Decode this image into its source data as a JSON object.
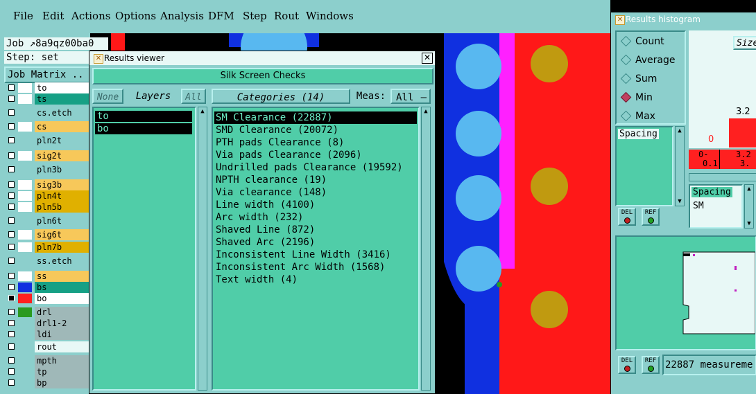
{
  "menu": [
    "File",
    "Edit",
    "Actions",
    "Options",
    "Analysis",
    "DFM",
    "Step",
    "Rout",
    "Windows"
  ],
  "job": {
    "label": "Job",
    "name": "8a9qz00ba0",
    "step_label": "Step: set",
    "matrix_label": "Job Matrix .."
  },
  "layers": [
    {
      "name": "to",
      "color": "#ffffff",
      "bg": "#ffffff"
    },
    {
      "name": "ts",
      "color": "#ffffff",
      "bg": "#16a085"
    },
    {
      "name": "cs.etch",
      "color": "#8ccfcc",
      "bg": "#8ccfcc"
    },
    {
      "name": "cs",
      "color": "#ffffff",
      "bg": "#f7c85a"
    },
    {
      "name": "pln2t",
      "color": "#8ccfcc",
      "bg": "#8ccfcc"
    },
    {
      "name": "sig2t",
      "color": "#ffffff",
      "bg": "#f7c85a"
    },
    {
      "name": "pln3b",
      "color": "#8ccfcc",
      "bg": "#8ccfcc"
    },
    {
      "name": "sig3b",
      "color": "#ffffff",
      "bg": "#f7c85a"
    },
    {
      "name": "pln4t",
      "color": "#ffffff",
      "bg": "#e0b000"
    },
    {
      "name": "pln5b",
      "color": "#ffffff",
      "bg": "#e0b000"
    },
    {
      "name": "pln6t",
      "color": "#8ccfcc",
      "bg": "#8ccfcc"
    },
    {
      "name": "sig6t",
      "color": "#ffffff",
      "bg": "#f7c85a"
    },
    {
      "name": "pln7b",
      "color": "#ffffff",
      "bg": "#e0b000"
    },
    {
      "name": "ss.etch",
      "color": "#8ccfcc",
      "bg": "#8ccfcc"
    },
    {
      "name": "ss",
      "color": "#ffffff",
      "bg": "#f7c85a"
    },
    {
      "name": "bs",
      "color": "#1030e0",
      "bg": "#16a085"
    },
    {
      "name": "bo",
      "color": "#ff2020",
      "bg": "#ffffff",
      "checked": true
    },
    {
      "name": "drl",
      "color": "#2a9a20",
      "bg": "#9fb8b8"
    },
    {
      "name": "drl1-2",
      "color": "#8ccfcc",
      "bg": "#9fb8b8"
    },
    {
      "name": "ldi",
      "color": "#8ccfcc",
      "bg": "#9fb8b8"
    },
    {
      "name": "rout",
      "color": "#8ccfcc",
      "bg": "#e8f8f6"
    },
    {
      "name": "mpth",
      "color": "#8ccfcc",
      "bg": "#9fb8b8"
    },
    {
      "name": "tp",
      "color": "#8ccfcc",
      "bg": "#9fb8b8"
    },
    {
      "name": "bp",
      "color": "#8ccfcc",
      "bg": "#9fb8b8"
    }
  ],
  "results_viewer": {
    "title": "Results viewer",
    "section": "Silk Screen Checks",
    "none_btn": "None",
    "layers_label": "Layers",
    "all_btn": "All",
    "categories_label": "Categories (14)",
    "meas_label": "Meas:",
    "meas_value": "All",
    "layer_list": [
      "to",
      "bo"
    ],
    "categories": [
      "SM Clearance (22887)",
      "SMD Clearance (20072)",
      "PTH pads Clearance (8)",
      "Via pads Clearance (2096)",
      "Undrilled pads Clearance (19592)",
      "NPTH clearance (19)",
      "Via clearance (148)",
      "Line width (4100)",
      "Arc width (232)",
      "Shaved Line (872)",
      "Shaved Arc (2196)",
      "Inconsistent Line Width (3416)",
      "Inconsistent Arc Width (1568)",
      "Text width (4)"
    ]
  },
  "histogram": {
    "title": "Results histogram",
    "options": [
      "Count",
      "Average",
      "Sum",
      "Min",
      "Max"
    ],
    "selected": "Min",
    "size_label": "Size",
    "list1": [
      "Spacing"
    ],
    "list2": [
      "Spacing",
      "SM"
    ],
    "zero": "0",
    "bar_label": "3.2",
    "bins": [
      "0-",
      "0.1",
      "3.2",
      "3."
    ],
    "del": "DEL",
    "ref": "REF",
    "status": "22887 measureme"
  },
  "colors": {
    "panel": "#8ccfcc",
    "list": "#50cda8",
    "canvas_blue": "#1030e0",
    "canvas_red": "#ff1818",
    "pad_lightblue": "#58b8f0",
    "pad_gold": "#c09a10",
    "magenta": "#ff20ff"
  }
}
